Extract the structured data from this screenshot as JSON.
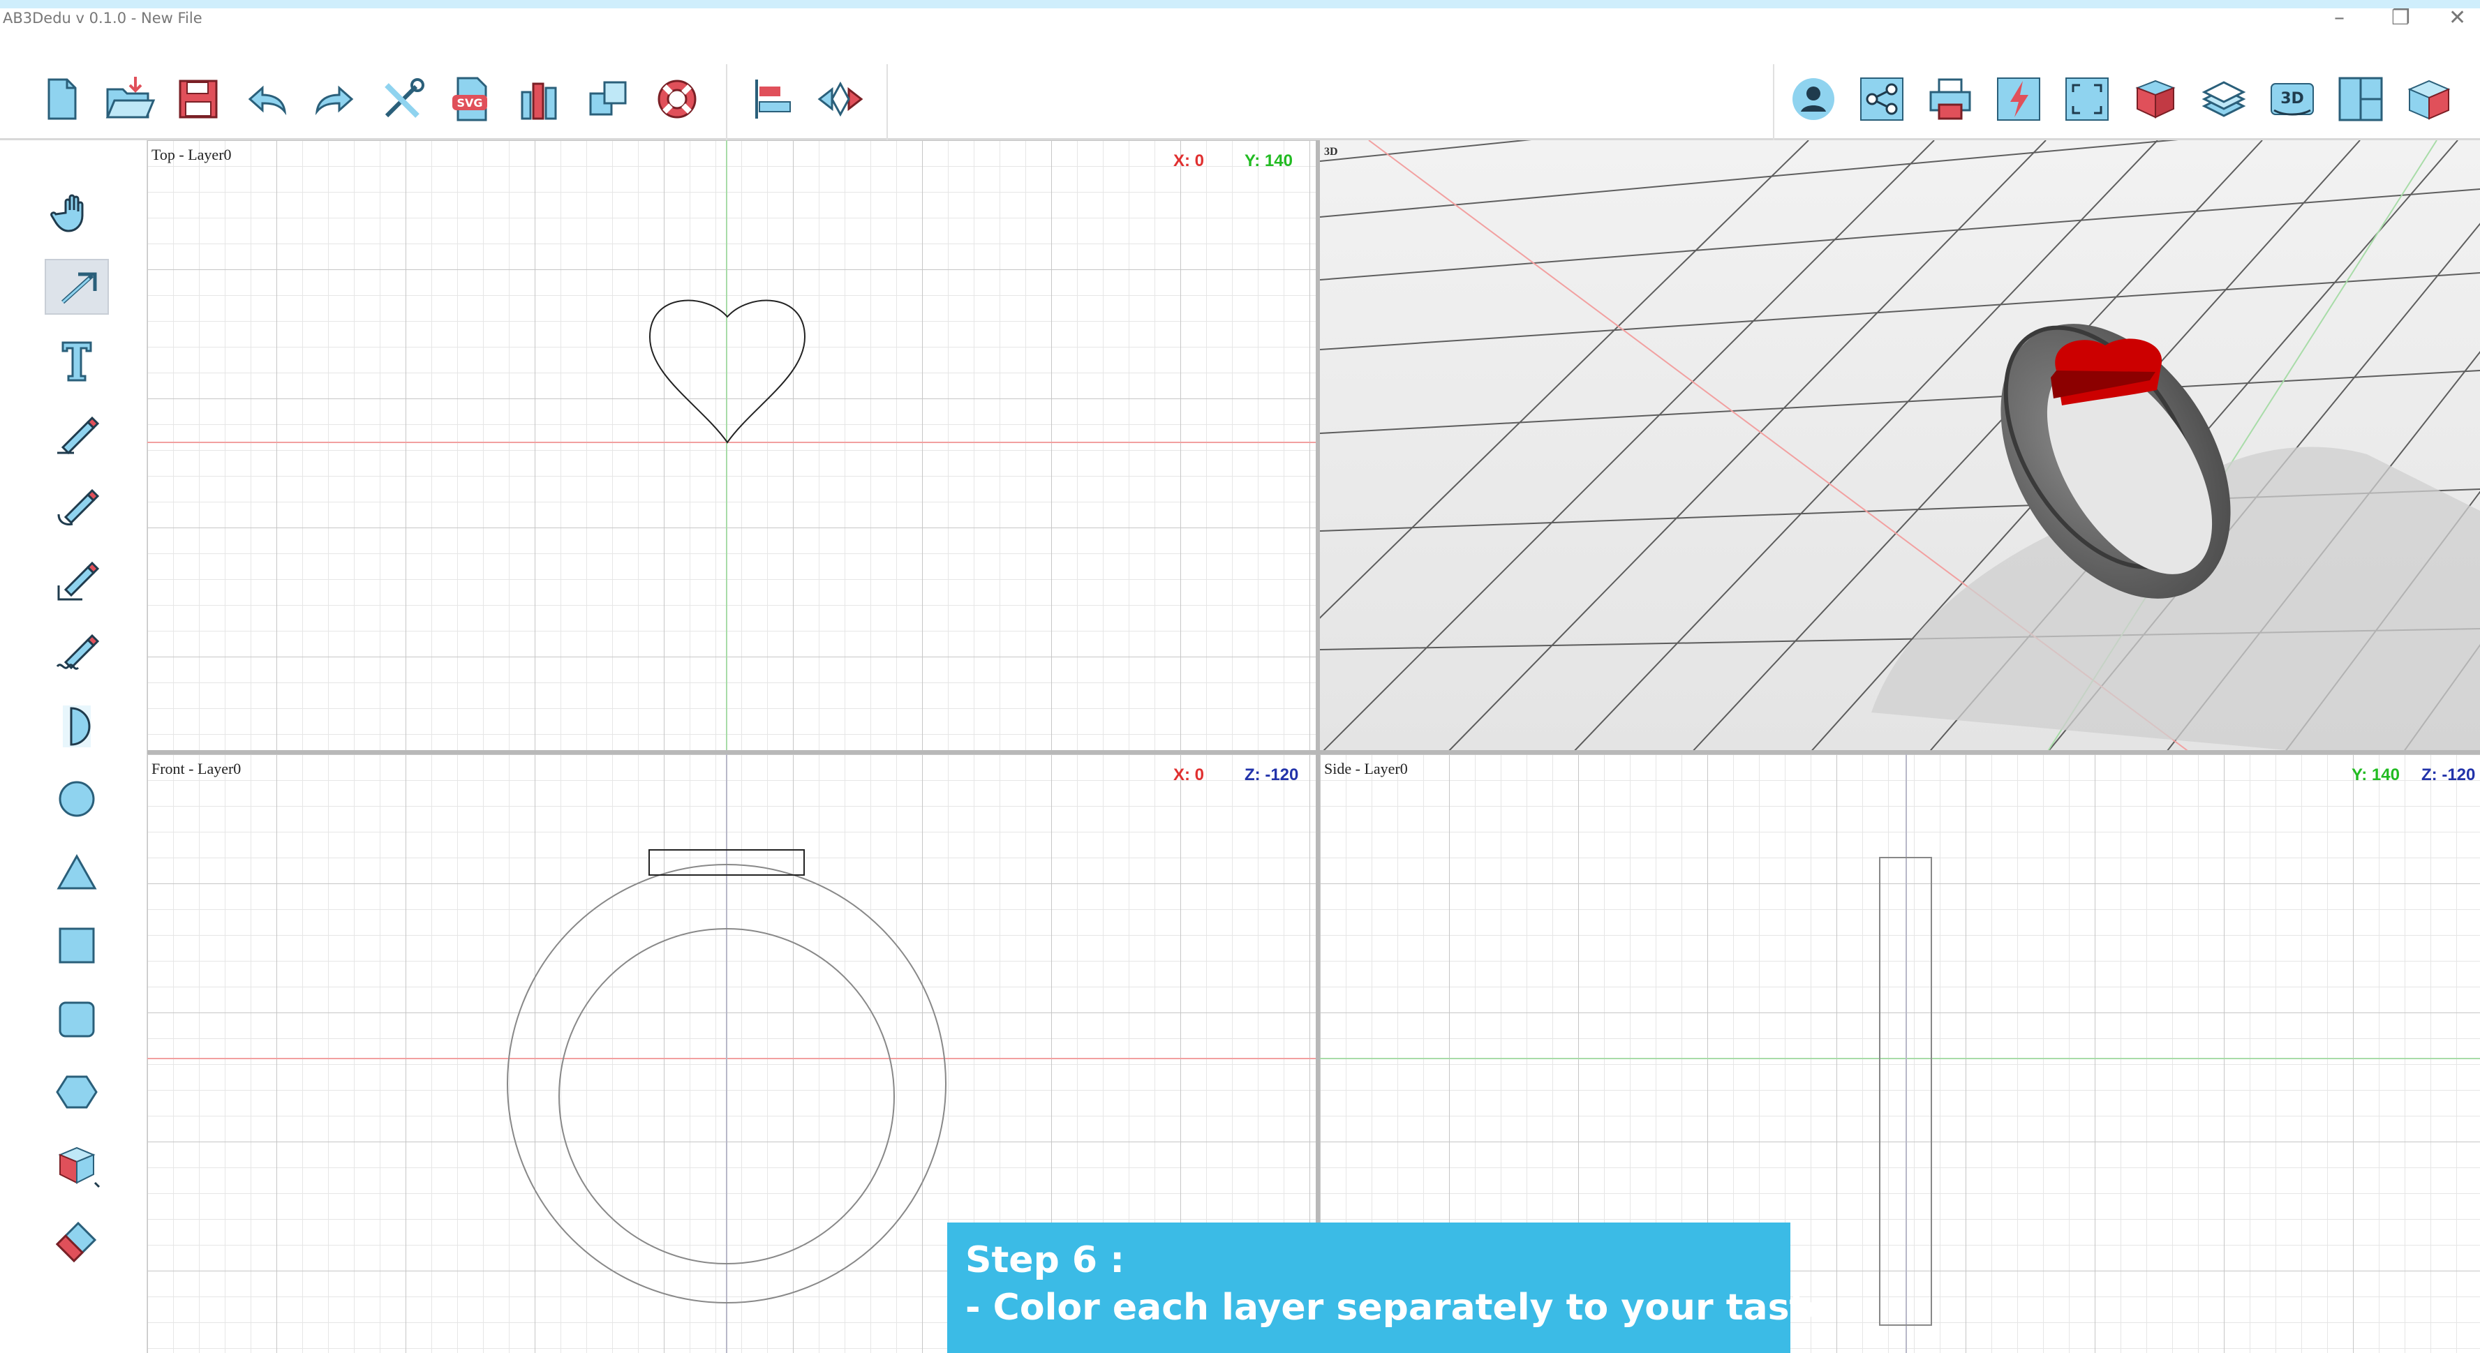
{
  "window": {
    "title": "AB3Dedu v 0.1.0 - New File",
    "controls": [
      "–",
      "❐",
      "✕"
    ]
  },
  "toolbar": {
    "left": [
      {
        "icon": "new-file-icon"
      },
      {
        "icon": "open-folder-icon"
      },
      {
        "icon": "save-icon"
      },
      {
        "icon": "undo-icon"
      },
      {
        "icon": "redo-icon"
      },
      {
        "icon": "tools-icon"
      },
      {
        "icon": "svg-import-icon"
      },
      {
        "icon": "library-icon"
      },
      {
        "icon": "duplicate-icon"
      },
      {
        "icon": "help-lifebuoy-icon"
      },
      {
        "icon": "align-icon"
      },
      {
        "icon": "mirror-icon"
      }
    ],
    "right": [
      {
        "icon": "user-icon"
      },
      {
        "icon": "share-icon"
      },
      {
        "icon": "print-icon"
      },
      {
        "icon": "lightning-icon"
      },
      {
        "icon": "fullscreen-icon"
      },
      {
        "icon": "color-cube-icon"
      },
      {
        "icon": "layers-icon"
      },
      {
        "icon": "3d-view-icon"
      },
      {
        "icon": "split-view-icon"
      },
      {
        "icon": "export-box-icon"
      }
    ]
  },
  "tools": [
    "hand-tool-icon",
    "select-arrow-icon",
    "text-tool-icon",
    "pencil-line-icon",
    "pencil-curve-icon",
    "pencil-angle-icon",
    "pencil-freehand-icon",
    "half-circle-icon",
    "circle-icon",
    "triangle-icon",
    "square-icon",
    "rounded-square-icon",
    "hexagon-icon",
    "extrude-box-icon",
    "eraser-icon"
  ],
  "colors": {
    "accent": "#3bbbe6",
    "x_axis": "#e03030",
    "y_axis": "#22bb22",
    "z_axis": "#2233aa",
    "icon_fill": "#8fd3ef",
    "icon_red": "#e0505a"
  },
  "viewports": {
    "top": {
      "label": "Top - Layer0",
      "c1": "X: 0",
      "c2": "Y: 140"
    },
    "view3d": {
      "label": "3D"
    },
    "front": {
      "label": "Front - Layer0",
      "c1": "X: 0",
      "c2": "Z: -120"
    },
    "side": {
      "label": "Side - Layer0",
      "c1": "Y: 140",
      "c2": "Z: -120"
    }
  },
  "callout": {
    "line1": "Step 6 :",
    "line2": "- Color each layer separately to your taste"
  }
}
